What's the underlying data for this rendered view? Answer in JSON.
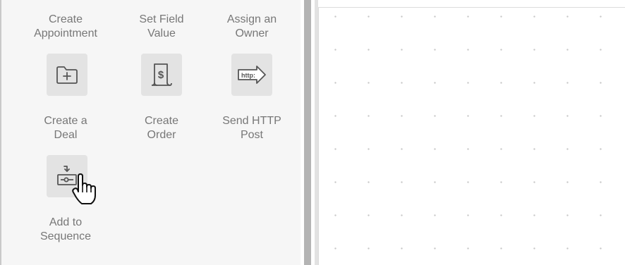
{
  "palette": {
    "items": [
      {
        "label": "Create\nAppointment",
        "icon": "calendar-plus-icon"
      },
      {
        "label": "Set Field\nValue",
        "icon": "field-value-icon"
      },
      {
        "label": "Assign an\nOwner",
        "icon": "owner-icon"
      },
      {
        "label": "Create a\nDeal",
        "icon": "folder-plus-icon"
      },
      {
        "label": "Create\nOrder",
        "icon": "dollar-receipt-icon"
      },
      {
        "label": "Send HTTP\nPost",
        "icon": "http-arrow-icon"
      },
      {
        "label": "Add to\nSequence",
        "icon": "sequence-icon"
      }
    ],
    "http_icon_text": "http:",
    "order_icon_text": "$"
  },
  "colors": {
    "panel_bg": "#f6f6f6",
    "tile_bg": "#e3e3e3",
    "label_text": "#777777",
    "icon_stroke": "#555555",
    "splitter": "#b4b4b4"
  },
  "cursor": "hand-pointer-icon"
}
